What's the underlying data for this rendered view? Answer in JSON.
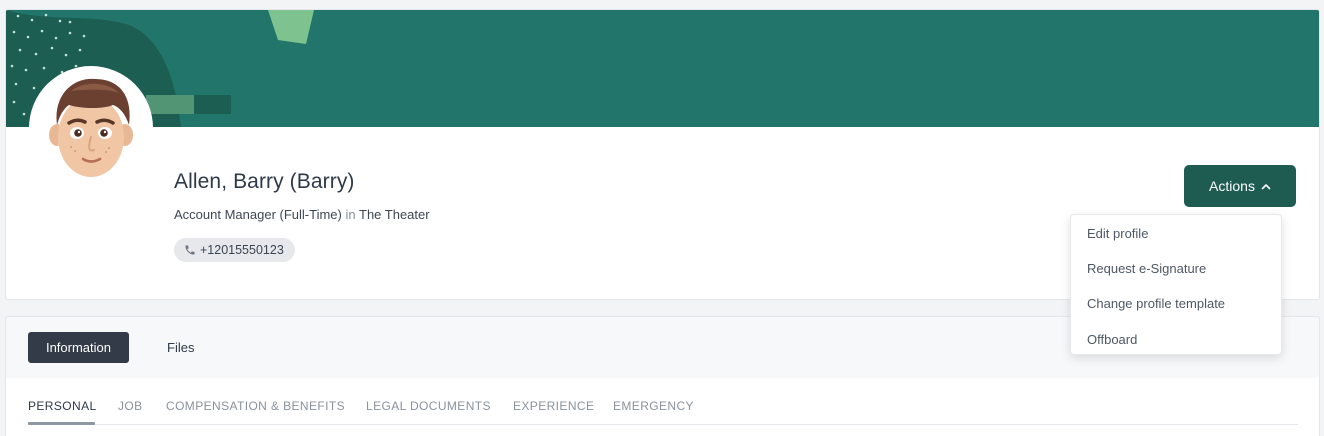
{
  "profile": {
    "name": "Allen, Barry (Barry)",
    "job_title": "Account Manager (Full-Time)",
    "in_word": "in",
    "location": "The Theater",
    "phone": "+12015550123"
  },
  "actions": {
    "label": "Actions",
    "menu": [
      "Edit profile",
      "Request e-Signature",
      "Change profile template",
      "Offboard"
    ]
  },
  "tabs": {
    "items": [
      "Information",
      "Files"
    ],
    "active": "Information"
  },
  "subtabs": {
    "items": [
      "PERSONAL",
      "JOB",
      "COMPENSATION & BENEFITS",
      "LEGAL DOCUMENTS",
      "EXPERIENCE",
      "EMERGENCY"
    ],
    "active": "PERSONAL"
  },
  "icons": {
    "phone": "phone-icon",
    "chevron": "chevron-up-icon",
    "avatar": "memoji-avatar"
  },
  "colors": {
    "banner": "#22756a",
    "banner_dark": "#1c5e52",
    "banner_light": "#7ec38f",
    "actions_button": "#1e5c52",
    "active_tab": "#323b47"
  }
}
